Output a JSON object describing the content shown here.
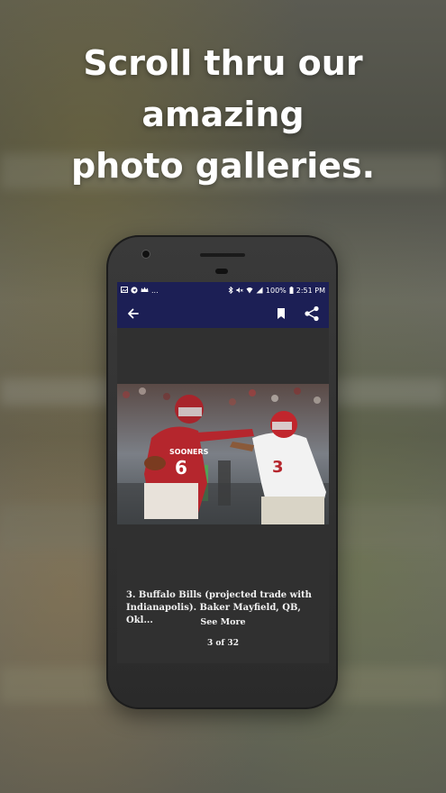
{
  "promo": {
    "headline_line1": "Scroll thru our amazing",
    "headline_line2": "photo galleries."
  },
  "status_bar": {
    "battery": "100%",
    "time": "2:51 PM",
    "dots": "..."
  },
  "app_bar": {
    "back_icon": "arrow-left-icon",
    "bookmark_icon": "bookmark-icon",
    "share_icon": "share-icon"
  },
  "gallery": {
    "caption": "3. Buffalo Bills (projected trade with Indianapolis). Baker Mayfield, QB, Okl...",
    "see_more": "See More",
    "counter": "3 of 32",
    "photo_jersey_text": "SOONERS",
    "photo_jersey_number": "6",
    "photo_opponent_number": "3"
  },
  "colors": {
    "app_bar": "#1c1f55",
    "screen_bg": "#303030",
    "text": "#f2f2f2"
  }
}
